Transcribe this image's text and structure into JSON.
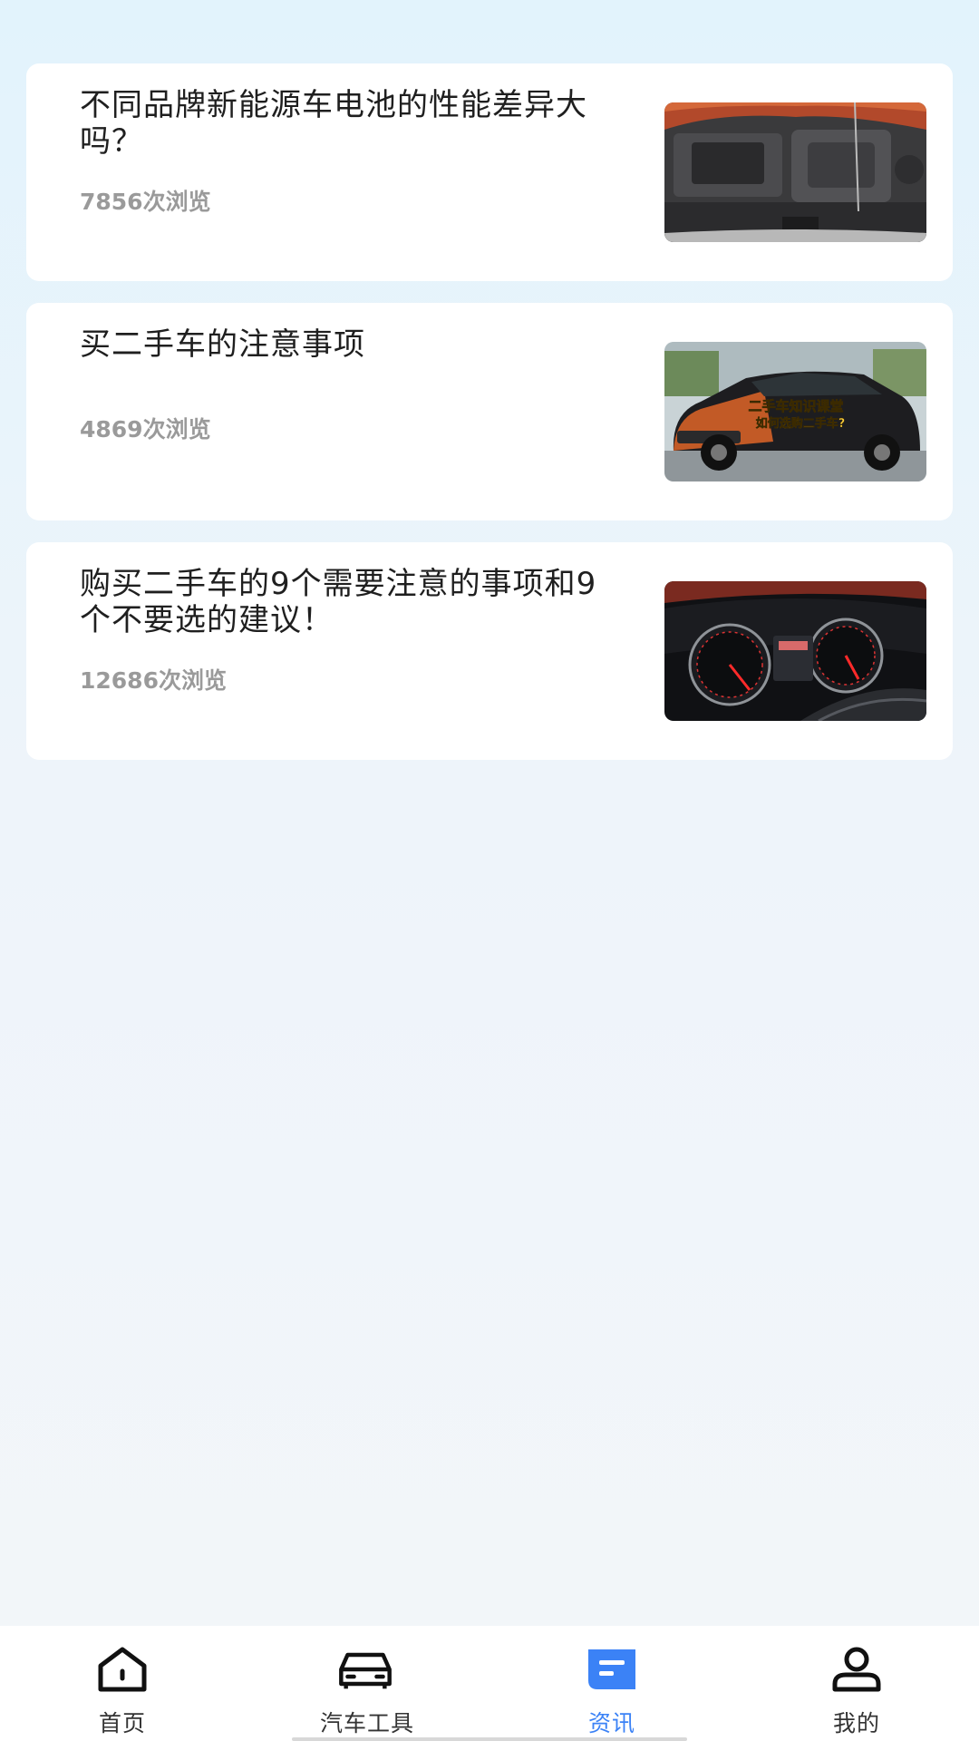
{
  "articles": [
    {
      "title": "不同品牌新能源车电池的性能差异大吗？",
      "views": "7856次浏览",
      "thumb_icon": "engine-bay-photo"
    },
    {
      "title": "买二手车的注意事项",
      "views": "4869次浏览",
      "thumb_icon": "suv-photo",
      "thumb_overlay_1": "二手车知识课堂",
      "thumb_overlay_2": "如何选购二手车?"
    },
    {
      "title": "购买二手车的9个需要注意的事项和9个不要选的建议！",
      "views": "12686次浏览",
      "thumb_icon": "dashboard-photo"
    }
  ],
  "tabbar": {
    "tabs": [
      {
        "label": "首页",
        "icon": "home-icon"
      },
      {
        "label": "汽车工具",
        "icon": "car-icon"
      },
      {
        "label": "资讯",
        "icon": "news-icon",
        "active": true
      },
      {
        "label": "我的",
        "icon": "user-icon"
      }
    ]
  },
  "colors": {
    "accent": "#3b82f6",
    "card_bg": "#ffffff",
    "title_text": "#1f1f1f",
    "muted_text": "#9a9a9a"
  }
}
